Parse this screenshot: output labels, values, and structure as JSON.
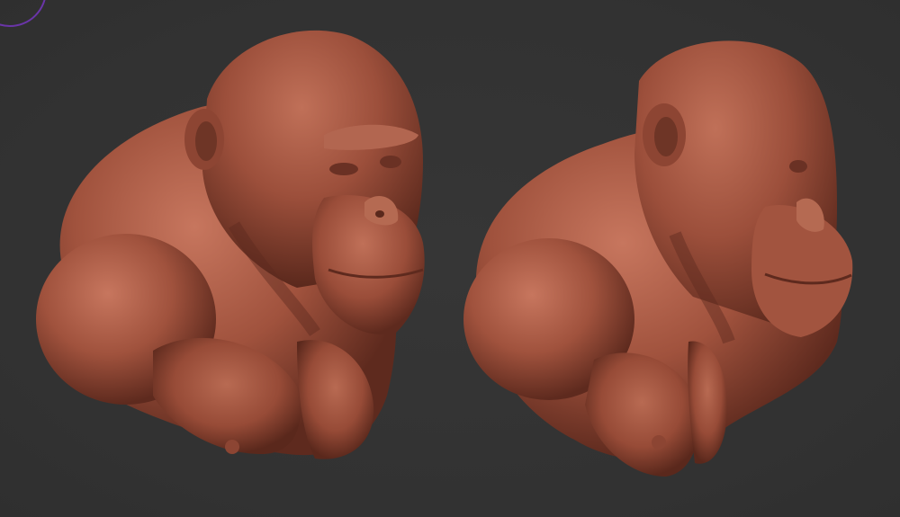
{
  "viewport": {
    "background_color": "#333333",
    "clay_color": "#a0523d",
    "clay_highlight": "#c7765e",
    "clay_shadow": "#5e2a1e"
  },
  "gizmo": {
    "icon": "orbit-gizmo-icon",
    "color": "#6a35a8"
  },
  "sculpts": [
    {
      "name": "ape-bust-sculpt-front-three-quarter"
    },
    {
      "name": "ape-bust-sculpt-side-profile"
    }
  ]
}
